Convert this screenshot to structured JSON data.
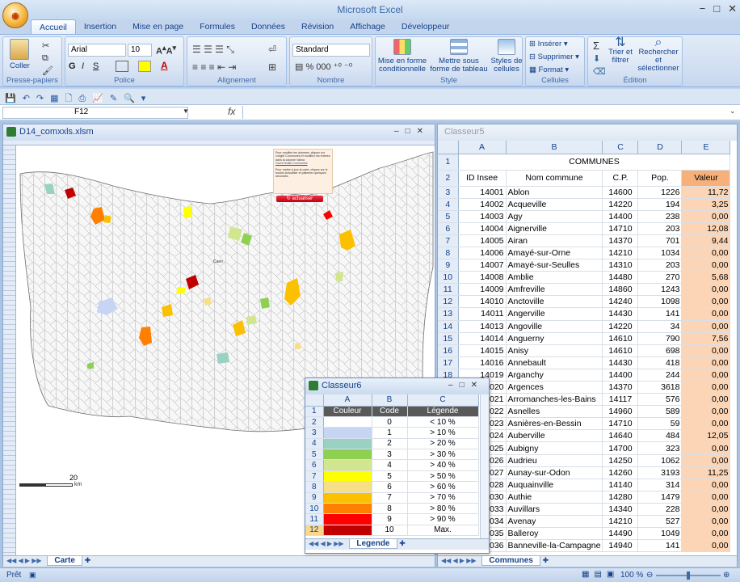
{
  "app": {
    "title": "Microsoft Excel",
    "office_button": "Office"
  },
  "tabs": [
    "Accueil",
    "Insertion",
    "Mise en page",
    "Formules",
    "Données",
    "Révision",
    "Affichage",
    "Développeur"
  ],
  "ribbon": {
    "clipboard": {
      "label": "Presse-papiers",
      "paste": "Coller"
    },
    "font": {
      "label": "Police",
      "name": "Arial",
      "size": "10"
    },
    "align": {
      "label": "Alignement"
    },
    "number": {
      "label": "Nombre",
      "format": "Standard"
    },
    "style": {
      "label": "Style",
      "cond": "Mise en forme conditionnelle",
      "table": "Mettre sous forme de tableau",
      "cells": "Styles de cellules"
    },
    "cells": {
      "label": "Cellules",
      "insert": "Insérer",
      "delete": "Supprimer",
      "format": "Format"
    },
    "edit": {
      "label": "Édition",
      "sort": "Trier et filtrer",
      "find": "Rechercher et sélectionner"
    }
  },
  "formula": {
    "cell": "F12",
    "fx": "fx",
    "value": ""
  },
  "mapwin": {
    "title": "D14_comxxls.xlsm",
    "tab": "Carte",
    "scale": "20",
    "unit": "km",
    "button": "actualiser",
    "note1": "Pour modifier les données, cliquez sur l'onglet Communes et modifiez les entrées dans la colonne Valeur.",
    "note2": "Pour mettre à jour la carte, cliquez sur le bouton Actualiser et patientez quelques secondes.",
    "note_link": "Ouvrir feuille Communes"
  },
  "c5": {
    "title": "Classeur5",
    "tab": "Communes",
    "cols": [
      "A",
      "B",
      "C",
      "D",
      "E"
    ],
    "header": "COMMUNES",
    "col_titles": [
      "ID Insee",
      "Nom commune",
      "C.P.",
      "Pop.",
      "Valeur"
    ],
    "rows": [
      [
        "3",
        "14001",
        "Ablon",
        "14600",
        "1226",
        "11,72"
      ],
      [
        "4",
        "14002",
        "Acqueville",
        "14220",
        "194",
        "3,25"
      ],
      [
        "5",
        "14003",
        "Agy",
        "14400",
        "238",
        "0,00"
      ],
      [
        "6",
        "14004",
        "Aignerville",
        "14710",
        "203",
        "12,08"
      ],
      [
        "7",
        "14005",
        "Airan",
        "14370",
        "701",
        "9,44"
      ],
      [
        "8",
        "14006",
        "Amayé-sur-Orne",
        "14210",
        "1034",
        "0,00"
      ],
      [
        "9",
        "14007",
        "Amayé-sur-Seulles",
        "14310",
        "203",
        "0,00"
      ],
      [
        "10",
        "14008",
        "Amblie",
        "14480",
        "270",
        "5,68"
      ],
      [
        "11",
        "14009",
        "Amfreville",
        "14860",
        "1243",
        "0,00"
      ],
      [
        "12",
        "14010",
        "Anctoville",
        "14240",
        "1098",
        "0,00"
      ],
      [
        "13",
        "14011",
        "Angerville",
        "14430",
        "141",
        "0,00"
      ],
      [
        "14",
        "14013",
        "Angoville",
        "14220",
        "34",
        "0,00"
      ],
      [
        "15",
        "14014",
        "Anguerny",
        "14610",
        "790",
        "7,56"
      ],
      [
        "16",
        "14015",
        "Anisy",
        "14610",
        "698",
        "0,00"
      ],
      [
        "17",
        "14016",
        "Annebault",
        "14430",
        "418",
        "0,00"
      ],
      [
        "18",
        "14019",
        "Arganchy",
        "14400",
        "244",
        "0,00"
      ],
      [
        "19",
        "14020",
        "Argences",
        "14370",
        "3618",
        "0,00"
      ],
      [
        "20",
        "14021",
        "Arromanches-les-Bains",
        "14117",
        "576",
        "0,00"
      ],
      [
        "21",
        "14022",
        "Asnelles",
        "14960",
        "589",
        "0,00"
      ],
      [
        "22",
        "14023",
        "Asnières-en-Bessin",
        "14710",
        "59",
        "0,00"
      ],
      [
        "23",
        "14024",
        "Auberville",
        "14640",
        "484",
        "12,05"
      ],
      [
        "24",
        "14025",
        "Aubigny",
        "14700",
        "323",
        "0,00"
      ],
      [
        "25",
        "14026",
        "Audrieu",
        "14250",
        "1062",
        "0,00"
      ],
      [
        "26",
        "14027",
        "Aunay-sur-Odon",
        "14260",
        "3193",
        "11,25"
      ],
      [
        "27",
        "14028",
        "Auquainville",
        "14140",
        "314",
        "0,00"
      ],
      [
        "28",
        "14030",
        "Authie",
        "14280",
        "1479",
        "0,00"
      ],
      [
        "29",
        "14033",
        "Auvillars",
        "14340",
        "228",
        "0,00"
      ],
      [
        "30",
        "14034",
        "Avenay",
        "14210",
        "527",
        "0,00"
      ],
      [
        "31",
        "14035",
        "Balleroy",
        "14490",
        "1049",
        "0,00"
      ],
      [
        "32",
        "14036",
        "Banneville-la-Campagne",
        "14940",
        "141",
        "0,00"
      ]
    ]
  },
  "c6": {
    "title": "Classeur6",
    "tab": "Legende",
    "cols": [
      "A",
      "B",
      "C"
    ],
    "head": [
      "Couleur",
      "Code",
      "Légende"
    ],
    "rows": [
      {
        "code": "0",
        "lab": "< 10 %",
        "color": "#ffffff"
      },
      {
        "code": "1",
        "lab": "> 10 %",
        "color": "#c5d5f3"
      },
      {
        "code": "2",
        "lab": "> 20 %",
        "color": "#99d2c2"
      },
      {
        "code": "3",
        "lab": "> 30 %",
        "color": "#8fd053"
      },
      {
        "code": "4",
        "lab": "> 40 %",
        "color": "#d2e58f"
      },
      {
        "code": "5",
        "lab": "> 50 %",
        "color": "#ffff00"
      },
      {
        "code": "6",
        "lab": "> 60 %",
        "color": "#f6df84"
      },
      {
        "code": "7",
        "lab": "> 70 %",
        "color": "#fbc000"
      },
      {
        "code": "8",
        "lab": "> 80 %",
        "color": "#ff7f00"
      },
      {
        "code": "9",
        "lab": "> 90 %",
        "color": "#ff0000"
      },
      {
        "code": "10",
        "lab": "Max.",
        "color": "#c00000"
      }
    ]
  },
  "status": {
    "ready": "Prêt",
    "zoom": "100 %"
  }
}
